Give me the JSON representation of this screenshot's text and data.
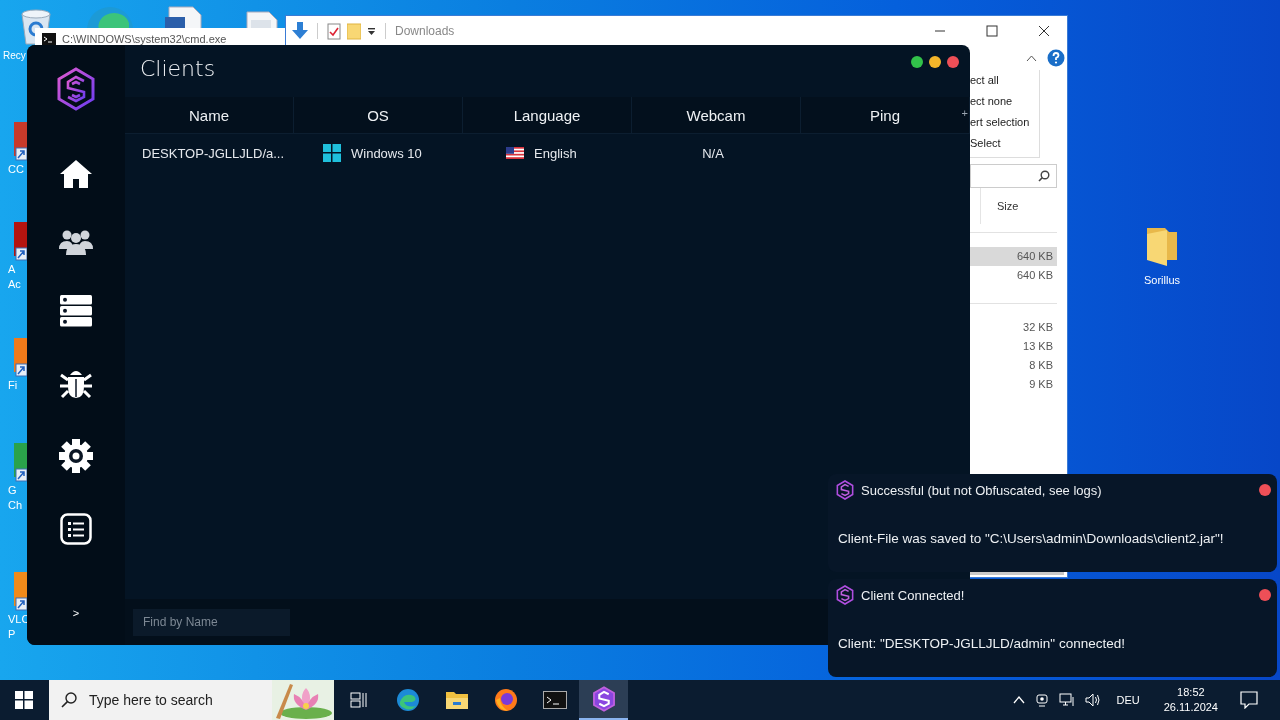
{
  "desktop": {
    "recycle_bin_label": "Recy",
    "side_icons": [
      {
        "lines": [
          "CC"
        ]
      },
      {
        "lines": [
          "A",
          "Ac"
        ]
      },
      {
        "lines": [
          "Fi"
        ]
      },
      {
        "lines": [
          "G",
          "Ch"
        ]
      },
      {
        "lines": [
          "VLC",
          "P"
        ]
      }
    ],
    "folder_label": "Sorillus"
  },
  "cmd_window": {
    "title": "C:\\WINDOWS\\system32\\cmd.exe"
  },
  "explorer_window": {
    "title": "Downloads",
    "ribbon_items": [
      "ect all",
      "ect none",
      "ert selection",
      "Select"
    ],
    "column": "Size",
    "file_groups": [
      [
        {
          "size": "640 KB",
          "selected": true
        },
        {
          "size": "640 KB",
          "selected": false
        }
      ],
      [
        {
          "size": "32 KB",
          "selected": false
        },
        {
          "size": "13 KB",
          "selected": false
        },
        {
          "size": "8 KB",
          "selected": false
        },
        {
          "size": "9 KB",
          "selected": false
        }
      ]
    ]
  },
  "app": {
    "title": "Clients",
    "sidebar": [
      {
        "kind": "home"
      },
      {
        "kind": "users"
      },
      {
        "kind": "server"
      },
      {
        "kind": "bug"
      },
      {
        "kind": "settings"
      },
      {
        "kind": "list"
      }
    ],
    "expand": ">",
    "table": {
      "columns": [
        "Name",
        "OS",
        "Language",
        "Webcam",
        "Ping"
      ],
      "header_extra": "+",
      "rows": [
        {
          "cells": [
            "DESKTOP-JGLLJLD/a...",
            "Windows 10",
            "English",
            "N/A"
          ]
        }
      ]
    },
    "search": {
      "placeholder": "Find by Name"
    }
  },
  "notifications": [
    {
      "title": "Successful (but not Obfuscated, see logs)",
      "message": "Client-File was saved to \"C:\\Users\\admin\\Downloads\\client2.jar\"!"
    },
    {
      "title": "Client Connected!",
      "message": "Client: \"DESKTOP-JGLLJLD/admin\" connected!"
    }
  ],
  "taskbar": {
    "search_placeholder": "Type here to search",
    "apps": [
      {
        "kind": "taskview",
        "selected": false
      },
      {
        "kind": "edge",
        "selected": false
      },
      {
        "kind": "explorer",
        "selected": false
      },
      {
        "kind": "firefox",
        "selected": false
      },
      {
        "kind": "terminal",
        "selected": false
      },
      {
        "kind": "sorillus",
        "selected": true
      }
    ],
    "language": "DEU",
    "time": "18:52",
    "date": "26.11.2024"
  }
}
